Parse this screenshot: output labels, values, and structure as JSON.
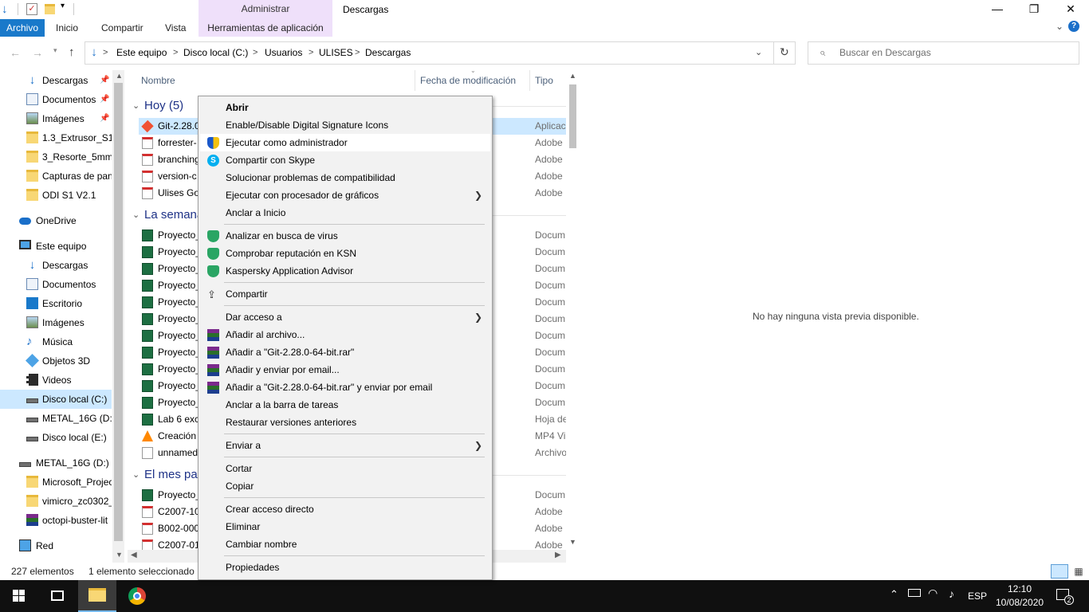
{
  "window": {
    "title": "Descargas",
    "minimize": "—",
    "maximize": "❐",
    "close": "✕"
  },
  "ribbon": {
    "context_group": "Administrar",
    "tabs": [
      "Archivo",
      "Inicio",
      "Compartir",
      "Vista"
    ],
    "context_tab": "Herramientas de aplicación",
    "expand": "⌄",
    "help": "?"
  },
  "address": {
    "crumbs": [
      "Este equipo",
      "Disco local (C:)",
      "Usuarios",
      "ULISES",
      "Descargas"
    ],
    "separator": ">",
    "search_placeholder": "Buscar en Descargas"
  },
  "nav": {
    "quick": [
      {
        "label": "Descargas",
        "icon": "download-icon",
        "pinned": true
      },
      {
        "label": "Documentos",
        "icon": "documents-icon",
        "pinned": true
      },
      {
        "label": "Imágenes",
        "icon": "pictures-icon",
        "pinned": true
      },
      {
        "label": "1.3_Extrusor_S1_",
        "icon": "folder-icon"
      },
      {
        "label": "3_Resorte_5mm_",
        "icon": "folder-icon"
      },
      {
        "label": "Capturas de pan",
        "icon": "folder-icon"
      },
      {
        "label": "ODI S1 V2.1",
        "icon": "folder-icon"
      }
    ],
    "onedrive": "OneDrive",
    "this_pc": "Este equipo",
    "pc_items": [
      {
        "label": "Descargas",
        "icon": "download-icon"
      },
      {
        "label": "Documentos",
        "icon": "documents-icon"
      },
      {
        "label": "Escritorio",
        "icon": "desktop-icon"
      },
      {
        "label": "Imágenes",
        "icon": "pictures-icon"
      },
      {
        "label": "Música",
        "icon": "music-icon"
      },
      {
        "label": "Objetos 3D",
        "icon": "3d-objects-icon"
      },
      {
        "label": "Videos",
        "icon": "videos-icon"
      },
      {
        "label": "Disco local (C:)",
        "icon": "drive-icon",
        "selected": true
      },
      {
        "label": "METAL_16G (D:)",
        "icon": "drive-icon"
      },
      {
        "label": "Disco local (E:)",
        "icon": "drive-icon"
      }
    ],
    "usb": "METAL_16G (D:)",
    "usb_items": [
      {
        "label": "Microsoft_Projec",
        "icon": "folder-icon"
      },
      {
        "label": "vimicro_zc0302_",
        "icon": "folder-icon"
      },
      {
        "label": "octopi-buster-lit",
        "icon": "rar-icon"
      }
    ],
    "network": "Red"
  },
  "files": {
    "columns": {
      "name": "Nombre",
      "modified": "Fecha de modificación",
      "type": "Tipo"
    },
    "groups": [
      {
        "label": "Hoy (5)"
      },
      {
        "label": "La semana"
      },
      {
        "label": "El mes pas"
      }
    ],
    "today": [
      {
        "name": "Git-2.28.0",
        "type": "Aplicac",
        "icon": "git-icon",
        "selected": true
      },
      {
        "name": "forrester-",
        "type": "Adobe",
        "icon": "pdf-icon"
      },
      {
        "name": "branching",
        "type": "Adobe",
        "icon": "pdf-icon"
      },
      {
        "name": "version-c",
        "type": "Adobe",
        "icon": "pdf-icon"
      },
      {
        "name": "Ulises Go",
        "type": "Adobe",
        "icon": "pdf-icon"
      }
    ],
    "week": [
      {
        "name": "Proyecto_",
        "type": "Docum",
        "icon": "excel-icon"
      },
      {
        "name": "Proyecto_",
        "type": "Docum",
        "icon": "excel-icon"
      },
      {
        "name": "Proyecto_",
        "type": "Docum",
        "icon": "excel-icon"
      },
      {
        "name": "Proyecto_",
        "type": "Docum",
        "icon": "excel-icon"
      },
      {
        "name": "Proyecto_",
        "type": "Docum",
        "icon": "excel-icon"
      },
      {
        "name": "Proyecto_",
        "type": "Docum",
        "icon": "excel-icon"
      },
      {
        "name": "Proyecto_",
        "type": "Docum",
        "icon": "excel-icon"
      },
      {
        "name": "Proyecto_",
        "type": "Docum",
        "icon": "excel-icon"
      },
      {
        "name": "Proyecto_",
        "type": "Docum",
        "icon": "excel-icon"
      },
      {
        "name": "Proyecto_",
        "type": "Docum",
        "icon": "excel-icon"
      },
      {
        "name": "Proyecto_",
        "type": "Docum",
        "icon": "excel-icon"
      },
      {
        "name": "Lab 6 exc",
        "type": "Hoja de",
        "icon": "excel-icon"
      },
      {
        "name": "Creación",
        "type": "MP4 Vi",
        "icon": "vlc-icon"
      },
      {
        "name": "unnamed",
        "type": "Archivo",
        "icon": "file-icon"
      }
    ],
    "month": [
      {
        "name": "Proyecto_",
        "type": "Docum",
        "icon": "excel-icon"
      },
      {
        "name": "C2007-10",
        "type": "Adobe",
        "icon": "pdf-icon"
      },
      {
        "name": "B002-000",
        "type": "Adobe",
        "icon": "pdf-icon"
      },
      {
        "name": "C2007-01",
        "type": "Adobe",
        "icon": "pdf-icon"
      }
    ]
  },
  "preview": {
    "message": "No hay ninguna vista previa disponible."
  },
  "status": {
    "count": "227 elementos",
    "selection": "1 elemento seleccionado"
  },
  "context_menu": {
    "items": [
      {
        "label": "Abrir",
        "bold": true
      },
      {
        "label": "Enable/Disable Digital Signature Icons"
      },
      {
        "label": "Ejecutar como administrador",
        "icon": "uac-shield-icon",
        "highlighted": true
      },
      {
        "label": "Compartir con Skype",
        "icon": "skype-icon"
      },
      {
        "label": "Solucionar problemas de compatibilidad"
      },
      {
        "label": "Ejecutar con procesador de gráficos",
        "submenu": true
      },
      {
        "label": "Anclar a Inicio"
      },
      {
        "separator": true
      },
      {
        "label": "Analizar en busca de virus",
        "icon": "kaspersky-icon"
      },
      {
        "label": "Comprobar reputación en KSN",
        "icon": "kaspersky-icon"
      },
      {
        "label": "Kaspersky Application Advisor",
        "icon": "kaspersky-icon"
      },
      {
        "separator": true
      },
      {
        "label": "Compartir",
        "icon": "share-icon"
      },
      {
        "separator": true
      },
      {
        "label": "Dar acceso a",
        "submenu": true
      },
      {
        "label": "Añadir al archivo...",
        "icon": "winrar-icon"
      },
      {
        "label": "Añadir a \"Git-2.28.0-64-bit.rar\"",
        "icon": "winrar-icon"
      },
      {
        "label": "Añadir y enviar por email...",
        "icon": "winrar-icon"
      },
      {
        "label": "Añadir a \"Git-2.28.0-64-bit.rar\" y enviar por email",
        "icon": "winrar-icon"
      },
      {
        "label": "Anclar a la barra de tareas"
      },
      {
        "label": "Restaurar versiones anteriores"
      },
      {
        "separator": true
      },
      {
        "label": "Enviar a",
        "submenu": true
      },
      {
        "separator": true
      },
      {
        "label": "Cortar"
      },
      {
        "label": "Copiar"
      },
      {
        "separator": true
      },
      {
        "label": "Crear acceso directo"
      },
      {
        "label": "Eliminar"
      },
      {
        "label": "Cambiar nombre"
      },
      {
        "separator": true
      },
      {
        "label": "Propiedades"
      }
    ]
  },
  "taskbar": {
    "language": "ESP",
    "time": "12:10",
    "date": "10/08/2020",
    "notifications": "2"
  },
  "colors": {
    "accent": "#1979ca",
    "selection": "#cce8ff",
    "context_tab": "#efe0fa",
    "taskbar": "#101010"
  }
}
